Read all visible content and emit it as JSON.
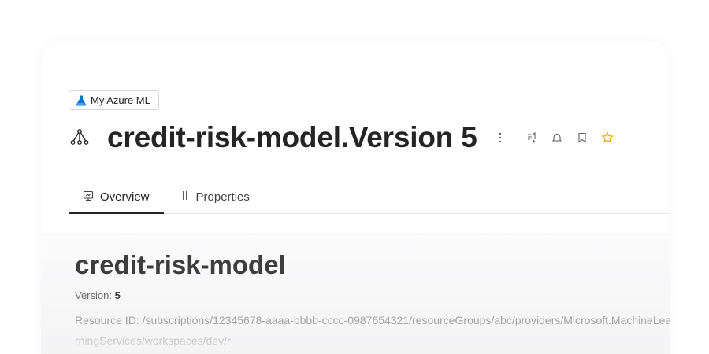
{
  "breadcrumb": {
    "label": "My Azure ML",
    "icon": "flask-icon",
    "icon_color": "#0078d4"
  },
  "header": {
    "title": "credit-risk-model.Version 5",
    "icon": "model-icon",
    "actions": [
      "more-icon",
      "compare-icon",
      "bell-icon",
      "bookmark-icon",
      "star-icon"
    ],
    "star_color": "#e8a317"
  },
  "tabs": [
    {
      "label": "Overview",
      "icon": "overview-icon",
      "active": true
    },
    {
      "label": "Properties",
      "icon": "hash-icon",
      "active": false
    }
  ],
  "main": {
    "model_name": "credit-risk-model",
    "version_label": "Version:",
    "version_value": "5",
    "resource_id": "Resource ID: /subscriptions/12345678-aaaa-bbbb-cccc-0987654321/resourceGroups/abc/providers/Microsoft.MachineLearningServices/workspaces/dev/r"
  }
}
